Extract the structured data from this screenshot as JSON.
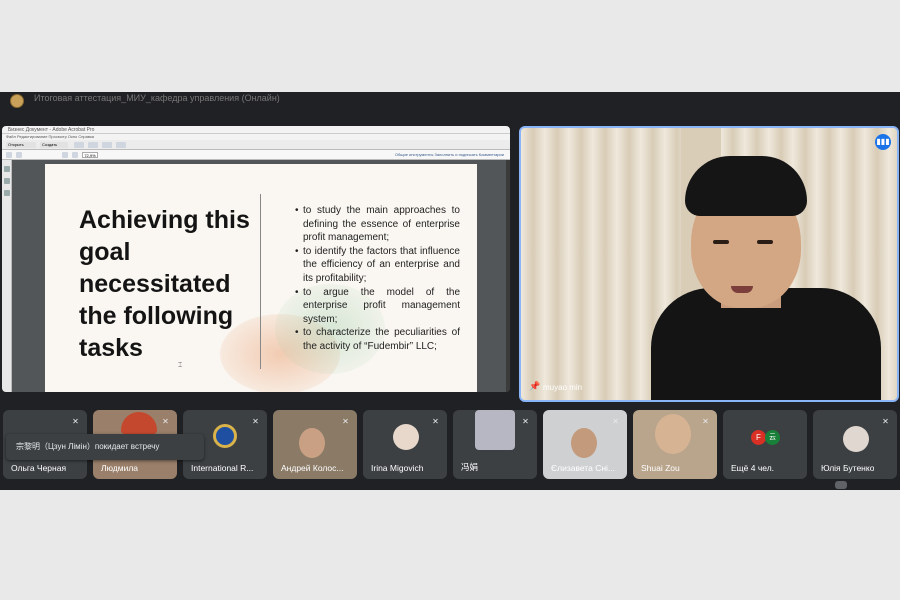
{
  "header": {
    "meeting_title": "Итоговая аттестация_МИУ_кафедра управления (Онлайн)"
  },
  "acrobat": {
    "window_title": "Бизнес Документ - Adobe Acrobat Pro",
    "menu": "Файл  Редактирование  Просмотр  Окно  Справка",
    "open_label": "Открыть",
    "create_label": "Создать",
    "zoom": "72,9%",
    "right_tools": "Общие инструменты    Заполнить и подписать    Комментарии"
  },
  "slide": {
    "heading": "Achieving this goal necessitated the following tasks",
    "tasks": [
      "to study the main approaches to defining the essence of enterprise profit management;",
      "to identify the factors that influence the efficiency of an enterprise and its profitability;",
      "to argue the model of the enterprise profit management system;",
      "to characterize the peculiarities of the activity of “Fudembir” LLC;"
    ]
  },
  "speaker": {
    "name": "muyao min",
    "pin_icon": "pin-icon",
    "indicator_icon": "audio-level-icon"
  },
  "toast": {
    "text": "宗黎明（Цзун Лімін）покидает встречу"
  },
  "participants": [
    {
      "name": "Ольга Черная"
    },
    {
      "name": "Людмила"
    },
    {
      "name": "International R..."
    },
    {
      "name": "Андрей Колос..."
    },
    {
      "name": "Irina Migovich"
    },
    {
      "name": "冯娟"
    },
    {
      "name": "Єлизавета Сні..."
    },
    {
      "name": "Shuai Zou"
    },
    {
      "name": "Ещё 4 чел.",
      "avatar_letters": [
        "F",
        "云"
      ]
    },
    {
      "name": "Юлія Бутенко"
    }
  ],
  "colors": {
    "meet_bg": "#202124",
    "tile_bg": "#3c4043",
    "speaking_border": "#8ab4f8",
    "accent": "#1a73e8"
  }
}
